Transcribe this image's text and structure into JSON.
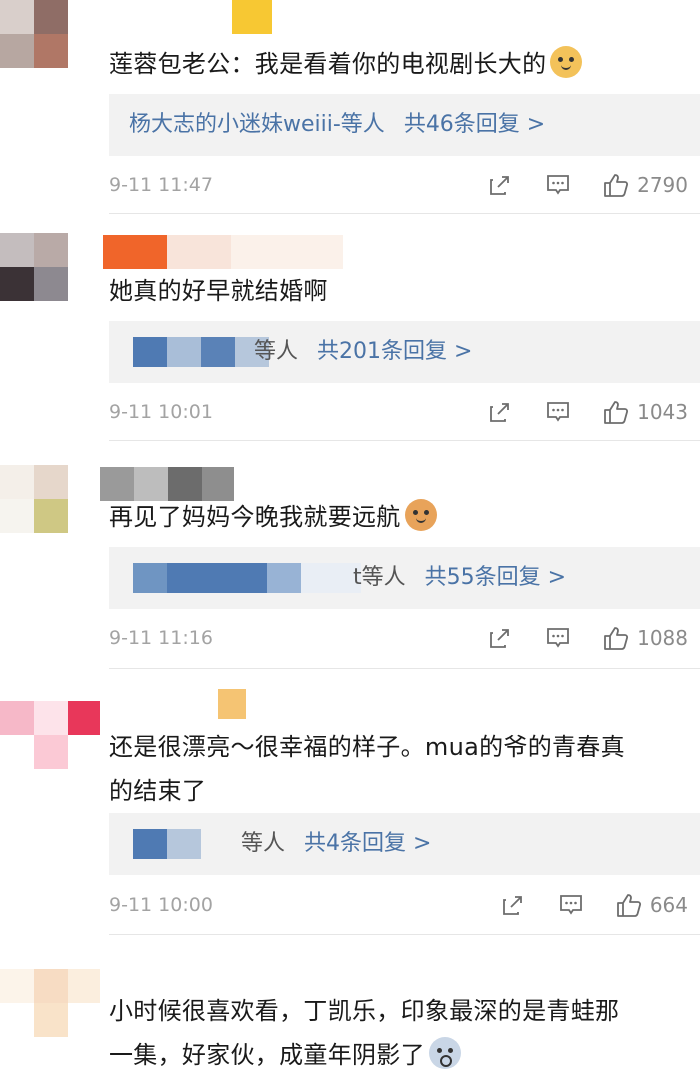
{
  "colors": {
    "link": "#4a73a6",
    "meta": "#a3a3a3",
    "reply_bg": "#f2f2f2",
    "divider": "#e6e6e6"
  },
  "comments": [
    {
      "text": "莲蓉包老公：我是看着你的电视剧长大的",
      "emoji": "doge-emoji",
      "reply_users": "杨大志的小迷妹weiii-等人",
      "reply_link": "共46条回复 >",
      "time": "9-11 11:47",
      "likes": "2790",
      "icons": [
        "share-icon",
        "comment-icon",
        "thumbs-up-icon"
      ]
    },
    {
      "text": "她真的好早就结婚啊",
      "emoji": "",
      "reply_users": "等人",
      "reply_link": "共201条回复 >",
      "time": "9-11 10:01",
      "likes": "1043",
      "icons": [
        "share-icon",
        "comment-icon",
        "thumbs-up-icon"
      ]
    },
    {
      "text": "再见了妈妈今晚我就要远航",
      "emoji": "cat-emoji",
      "reply_users": "t等人",
      "reply_link": "共55条回复 >",
      "time": "9-11 11:16",
      "likes": "1088",
      "icons": [
        "share-icon",
        "comment-icon",
        "thumbs-up-icon"
      ]
    },
    {
      "text": "还是很漂亮～很幸福的样子。mua的爷的青春真\n的结束了",
      "emoji": "",
      "reply_users": "等人",
      "reply_link": "共4条回复 >",
      "time": "9-11 10:00",
      "likes": "664",
      "icons": [
        "share-icon",
        "comment-icon",
        "thumbs-up-icon"
      ]
    },
    {
      "text": "小时候很喜欢看，丁凯乐，印象最深的是青蛙那\n一集，好家伙，成童年阴影了",
      "emoji": "scared-emoji"
    }
  ]
}
